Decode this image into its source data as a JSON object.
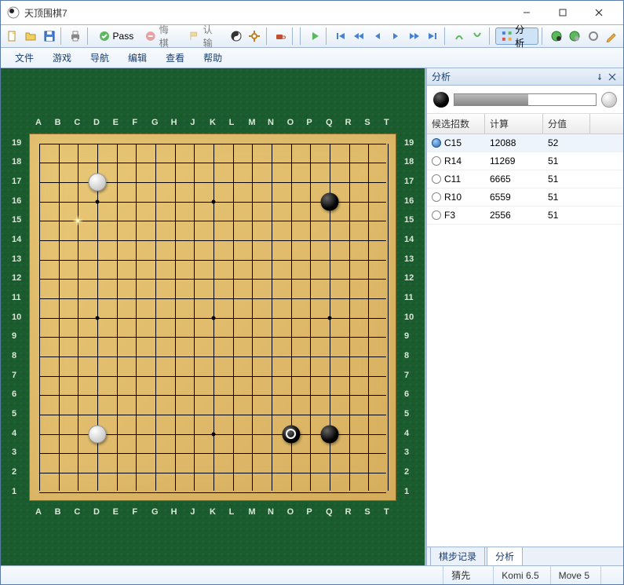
{
  "window": {
    "title": "天顶围棋7"
  },
  "toolbar": {
    "pass_label": "Pass",
    "undo_label": "悔棋",
    "confirm_label": "认输",
    "analysis_label": "分析"
  },
  "menu": {
    "file": "文件",
    "game": "游戏",
    "nav": "导航",
    "edit": "编辑",
    "view": "查看",
    "help": "帮助"
  },
  "board": {
    "size": 19,
    "col_labels": [
      "A",
      "B",
      "C",
      "D",
      "E",
      "F",
      "G",
      "H",
      "J",
      "K",
      "L",
      "M",
      "N",
      "O",
      "P",
      "Q",
      "R",
      "S",
      "T"
    ],
    "row_labels": [
      "19",
      "18",
      "17",
      "16",
      "15",
      "14",
      "13",
      "12",
      "11",
      "10",
      "9",
      "8",
      "7",
      "6",
      "5",
      "4",
      "3",
      "2",
      "1"
    ],
    "stars": [
      [
        3,
        3
      ],
      [
        3,
        9
      ],
      [
        3,
        15
      ],
      [
        9,
        3
      ],
      [
        9,
        9
      ],
      [
        9,
        15
      ],
      [
        15,
        3
      ],
      [
        15,
        9
      ],
      [
        15,
        15
      ]
    ],
    "stones": [
      {
        "col": 3,
        "row": 2,
        "color": "white"
      },
      {
        "col": 15,
        "row": 3,
        "color": "black"
      },
      {
        "col": 3,
        "row": 15,
        "color": "white"
      },
      {
        "col": 13,
        "row": 15,
        "color": "black",
        "last": true
      },
      {
        "col": 15,
        "row": 15,
        "color": "black"
      }
    ],
    "highlight": {
      "col": 2,
      "row": 4
    }
  },
  "panel": {
    "title": "分析",
    "eval_percent": 52,
    "columns": {
      "move": "候选招数",
      "calc": "计算",
      "score": "分值"
    },
    "rows": [
      {
        "move": "C15",
        "calc": "12088",
        "score": "52",
        "selected": true
      },
      {
        "move": "R14",
        "calc": "11269",
        "score": "51"
      },
      {
        "move": "C11",
        "calc": "6665",
        "score": "51"
      },
      {
        "move": "R10",
        "calc": "6559",
        "score": "51"
      },
      {
        "move": "F3",
        "calc": "2556",
        "score": "51"
      }
    ],
    "tabs": {
      "record": "棋步记录",
      "analysis": "分析"
    }
  },
  "status": {
    "turn": "猜先",
    "komi": "Komi 6.5",
    "move": "Move 5"
  }
}
